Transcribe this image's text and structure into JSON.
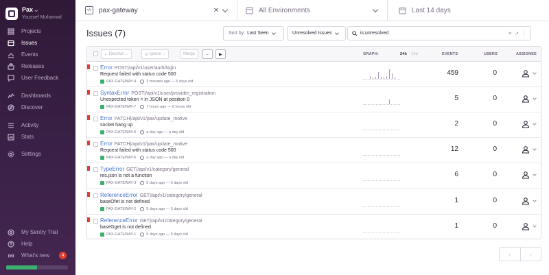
{
  "org": {
    "name": "Pax",
    "user": "Youssef Muhamad"
  },
  "nav": {
    "primary": [
      {
        "label": "Projects",
        "icon": "projects-icon"
      },
      {
        "label": "Issues",
        "icon": "issues-icon",
        "active": true
      },
      {
        "label": "Events",
        "icon": "events-icon"
      },
      {
        "label": "Releases",
        "icon": "releases-icon"
      },
      {
        "label": "User Feedback",
        "icon": "feedback-icon"
      }
    ],
    "secondary": [
      {
        "label": "Dashboards",
        "icon": "dashboards-icon"
      },
      {
        "label": "Discover",
        "icon": "discover-icon"
      }
    ],
    "tertiary": [
      {
        "label": "Activity",
        "icon": "activity-icon"
      },
      {
        "label": "Stats",
        "icon": "stats-icon"
      }
    ],
    "settings": {
      "label": "Settings",
      "icon": "gear-icon"
    },
    "bottom": [
      {
        "label": "My Sentry Trial",
        "icon": "trial-icon"
      },
      {
        "label": "Help",
        "icon": "help-icon"
      },
      {
        "label": "What's new",
        "icon": "broadcast-icon",
        "badge": "4"
      }
    ],
    "trial_progress": 0.5
  },
  "topbar": {
    "project": "pax-gateway",
    "environment": "All Environments",
    "date_range": "Last 14 days"
  },
  "issues": {
    "title": "Issues (7)",
    "sort_label": "Sort by:",
    "sort_value": "Last Seen",
    "filter_value": "Unresolved Issues",
    "search_value": "is:unresolved",
    "toolbar": {
      "resolve": "Resolve",
      "ignore": "Ignore",
      "merge": "Merge",
      "more": "...",
      "play": "▶"
    },
    "columns": {
      "graph": "GRAPH:",
      "graph_24h": "24h",
      "graph_14d": "14d",
      "events": "EVENTS",
      "users": "USERS",
      "assignee": "ASSIGNEE"
    },
    "rows": [
      {
        "type": "Error",
        "culprit": "POST|/api/v1/user/auth/login",
        "message": "Request failed with status code 500",
        "short_id": "PAX-GATEWAY-4",
        "time": "3 minutes ago — 5 days old",
        "events": "459",
        "users": "0",
        "graph": [
          0.3,
          0.15,
          0.25,
          0.7,
          0.2,
          0.15,
          0.3,
          1.0,
          0.6,
          0.2
        ]
      },
      {
        "type": "SyntaxError",
        "culprit": "POST|/api/v1/user/provider_registration",
        "message": "Unexpected token < in JSON at position 0",
        "short_id": "PAX-GATEWAY-7",
        "time": "7 hours ago — 8 hours old",
        "events": "5",
        "users": "0",
        "graph": [
          0,
          0,
          0,
          0,
          0,
          0,
          0,
          0.5,
          0,
          0
        ]
      },
      {
        "type": "Error",
        "culprit": "PATCH|/api/v1/pax/update_motive",
        "message": "socket hang up",
        "short_id": "PAX-GATEWAY-6",
        "time": "a day ago — a day old",
        "events": "2",
        "users": "0",
        "graph": [
          0,
          0,
          0,
          0,
          0,
          0,
          0,
          0,
          0,
          0
        ]
      },
      {
        "type": "Error",
        "culprit": "PATCH|/api/v1/pax/update_motive",
        "message": "Request failed with status code 500",
        "short_id": "PAX-GATEWAY-5",
        "time": "a day ago — a day old",
        "events": "12",
        "users": "0",
        "graph": [
          0,
          0,
          0,
          0,
          0,
          0,
          0,
          0,
          0,
          0
        ]
      },
      {
        "type": "TypeError",
        "culprit": "GET|/api/v1/category/general",
        "message": "res.json is not a function",
        "short_id": "PAX-GATEWAY-3",
        "time": "5 days ago — 5 days old",
        "events": "6",
        "users": "0",
        "graph": [
          0,
          0,
          0,
          0,
          0,
          0,
          0,
          0,
          0,
          0
        ]
      },
      {
        "type": "ReferenceError",
        "culprit": "GET|/api/v1/category/general",
        "message": "baseOfet is not defined",
        "short_id": "PAX-GATEWAY-2",
        "time": "5 days ago — 5 days old",
        "events": "1",
        "users": "0",
        "graph": [
          0,
          0,
          0,
          0,
          0,
          0,
          0,
          0,
          0,
          0
        ]
      },
      {
        "type": "ReferenceError",
        "culprit": "GET|/api/v1/category/general",
        "message": "baseGget is not defined",
        "short_id": "PAX-GATEWAY-1",
        "time": "5 days ago — 5 days old",
        "events": "1",
        "users": "0",
        "graph": [
          0,
          0,
          0,
          0,
          0,
          0,
          0,
          0,
          0,
          0
        ]
      }
    ]
  },
  "pager": {
    "prev": "‹",
    "next": "›"
  }
}
